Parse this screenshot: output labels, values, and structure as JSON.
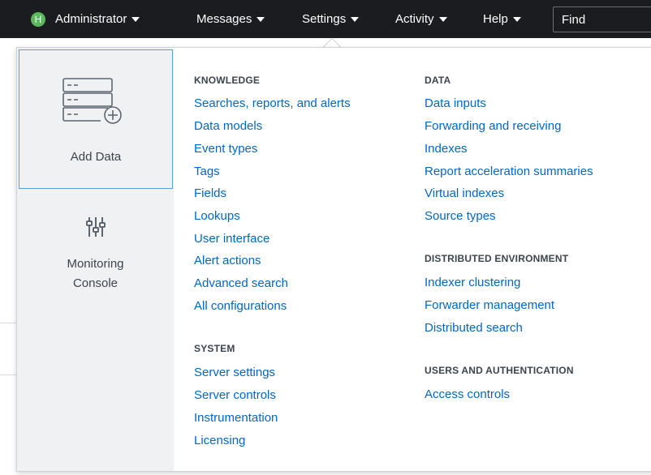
{
  "nav": {
    "avatar_letter": "H",
    "items": [
      {
        "label": "Administrator"
      },
      {
        "label": "Messages"
      },
      {
        "label": "Settings"
      },
      {
        "label": "Activity"
      },
      {
        "label": "Help"
      }
    ],
    "find_placeholder": "Find"
  },
  "side": {
    "add_data": {
      "label": "Add Data",
      "icon": "add-data-icon"
    },
    "monitoring": {
      "label_line1": "Monitoring",
      "label_line2": "Console",
      "icon": "sliders-icon"
    }
  },
  "knowledge": {
    "heading": "KNOWLEDGE",
    "links": [
      "Searches, reports, and alerts",
      "Data models",
      "Event types",
      "Tags",
      "Fields",
      "Lookups",
      "User interface",
      "Alert actions",
      "Advanced search",
      "All configurations"
    ]
  },
  "system": {
    "heading": "SYSTEM",
    "links": [
      "Server settings",
      "Server controls",
      "Instrumentation",
      "Licensing"
    ]
  },
  "data": {
    "heading": "DATA",
    "links": [
      "Data inputs",
      "Forwarding and receiving",
      "Indexes",
      "Report acceleration summaries",
      "Virtual indexes",
      "Source types"
    ]
  },
  "distributed": {
    "heading": "DISTRIBUTED ENVIRONMENT",
    "links": [
      "Indexer clustering",
      "Forwarder management",
      "Distributed search"
    ]
  },
  "users": {
    "heading": "USERS AND AUTHENTICATION",
    "links": [
      "Access controls"
    ]
  },
  "colors": {
    "topbar": "#1a1c20",
    "link": "#0066cc",
    "avatar": "#5cb85c",
    "selected_border": "#5aa0e0"
  }
}
